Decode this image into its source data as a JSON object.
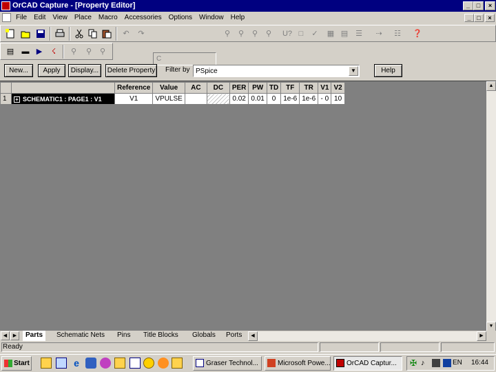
{
  "window": {
    "title": "OrCAD Capture - [Property Editor]",
    "caption_buttons": [
      "_",
      "□",
      "×"
    ]
  },
  "menu": {
    "items": [
      "File",
      "Edit",
      "View",
      "Place",
      "Macro",
      "Accessories",
      "Options",
      "Window",
      "Help"
    ]
  },
  "toolbar": {
    "combo_value": "C"
  },
  "editor": {
    "buttons": {
      "new": "New...",
      "apply": "Apply",
      "display": "Display...",
      "delete_property": "Delete Property",
      "help": "Help"
    },
    "filter_label": "Filter by",
    "filter_value": "PSpice"
  },
  "grid": {
    "columns": [
      "Reference",
      "Value",
      "AC",
      "DC",
      "PER",
      "PW",
      "TD",
      "TF",
      "TR",
      "V1",
      "V2"
    ],
    "rows": [
      {
        "index": "1",
        "expander": "+",
        "name": "SCHEMATIC1 : PAGE1 : V1",
        "cells": [
          "V1",
          "VPULSE",
          "",
          "",
          "0.02",
          "0.01",
          "0",
          "1e-6",
          "1e-6",
          "- 0",
          "10"
        ]
      }
    ]
  },
  "tabs": [
    "Parts",
    "Schematic Nets",
    "Pins",
    "Title Blocks",
    "Globals",
    "Ports"
  ],
  "active_tab": "Parts",
  "status": {
    "text": "Ready"
  },
  "taskbar": {
    "start_label": "Start",
    "tasks": [
      "Graser Technol...",
      "Microsoft Powe...",
      "OrCAD Captur..."
    ],
    "active_task": "OrCAD Captur...",
    "tray_lang": "EN",
    "clock": "16:44"
  },
  "colors": {
    "title_bar": "#000080",
    "face": "#d4d0c8",
    "selected_row": "#000000"
  }
}
